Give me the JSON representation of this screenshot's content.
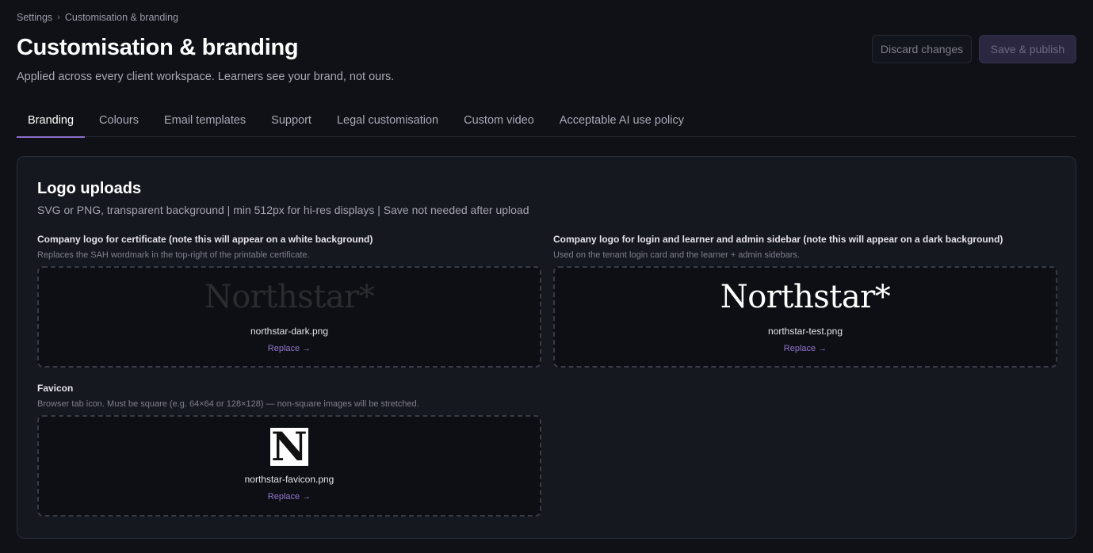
{
  "breadcrumb": {
    "items": [
      "Settings",
      "Customisation & branding"
    ],
    "separator": "›"
  },
  "header": {
    "title": "Customisation & branding",
    "subtitle": "Applied across every client workspace. Learners see your brand, not ours.",
    "discard_label": "Discard changes",
    "save_label": "Save & publish"
  },
  "tabs": [
    {
      "label": "Branding",
      "active": true
    },
    {
      "label": "Colours",
      "active": false
    },
    {
      "label": "Email templates",
      "active": false
    },
    {
      "label": "Support",
      "active": false
    },
    {
      "label": "Legal customisation",
      "active": false
    },
    {
      "label": "Custom video",
      "active": false
    },
    {
      "label": "Acceptable AI use policy",
      "active": false
    }
  ],
  "logo_uploads": {
    "title": "Logo uploads",
    "subtitle": "SVG or PNG, transparent background | min 512px for hi-res displays | Save not needed after upload",
    "certificate_logo": {
      "label": "Company logo for certificate (note this will appear on a white background)",
      "help": "Replaces the SAH wordmark in the top-right of the printable certificate.",
      "preview_text": "Northstar*",
      "file_name": "northstar-dark.png",
      "replace_label": "Replace →"
    },
    "sidebar_logo": {
      "label": "Company logo for login and learner and admin sidebar (note this will appear on a dark background)",
      "help": "Used on the tenant login card and the learner + admin sidebars.",
      "preview_text": "Northstar*",
      "file_name": "northstar-test.png",
      "replace_label": "Replace →"
    },
    "favicon": {
      "label": "Favicon",
      "help": "Browser tab icon. Must be square (e.g. 64×64 or 128×128) — non-square images will be stretched.",
      "preview_letter": "N",
      "file_name": "northstar-favicon.png",
      "replace_label": "Replace →"
    }
  },
  "colors": {
    "accent": "#8b6fc9",
    "background": "#0f1117",
    "card": "#161820"
  }
}
